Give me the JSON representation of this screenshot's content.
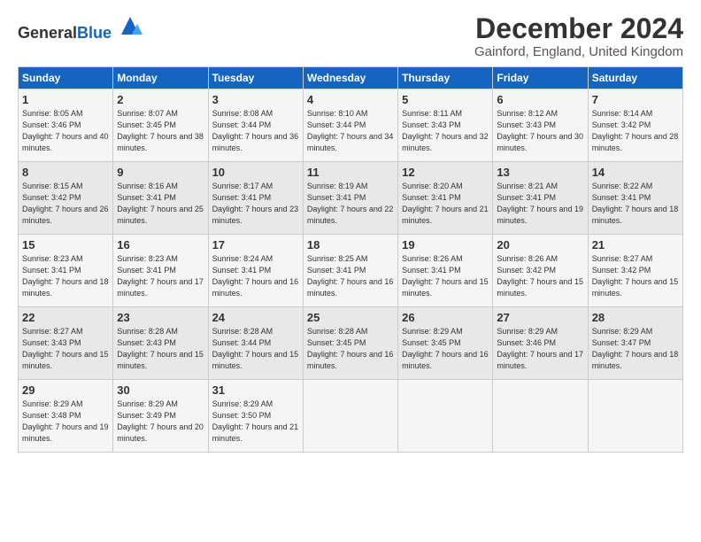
{
  "header": {
    "logo_general": "General",
    "logo_blue": "Blue",
    "month_title": "December 2024",
    "location": "Gainford, England, United Kingdom"
  },
  "days_of_week": [
    "Sunday",
    "Monday",
    "Tuesday",
    "Wednesday",
    "Thursday",
    "Friday",
    "Saturday"
  ],
  "weeks": [
    [
      {
        "day": "1",
        "sunrise": "Sunrise: 8:05 AM",
        "sunset": "Sunset: 3:46 PM",
        "daylight": "Daylight: 7 hours and 40 minutes."
      },
      {
        "day": "2",
        "sunrise": "Sunrise: 8:07 AM",
        "sunset": "Sunset: 3:45 PM",
        "daylight": "Daylight: 7 hours and 38 minutes."
      },
      {
        "day": "3",
        "sunrise": "Sunrise: 8:08 AM",
        "sunset": "Sunset: 3:44 PM",
        "daylight": "Daylight: 7 hours and 36 minutes."
      },
      {
        "day": "4",
        "sunrise": "Sunrise: 8:10 AM",
        "sunset": "Sunset: 3:44 PM",
        "daylight": "Daylight: 7 hours and 34 minutes."
      },
      {
        "day": "5",
        "sunrise": "Sunrise: 8:11 AM",
        "sunset": "Sunset: 3:43 PM",
        "daylight": "Daylight: 7 hours and 32 minutes."
      },
      {
        "day": "6",
        "sunrise": "Sunrise: 8:12 AM",
        "sunset": "Sunset: 3:43 PM",
        "daylight": "Daylight: 7 hours and 30 minutes."
      },
      {
        "day": "7",
        "sunrise": "Sunrise: 8:14 AM",
        "sunset": "Sunset: 3:42 PM",
        "daylight": "Daylight: 7 hours and 28 minutes."
      }
    ],
    [
      {
        "day": "8",
        "sunrise": "Sunrise: 8:15 AM",
        "sunset": "Sunset: 3:42 PM",
        "daylight": "Daylight: 7 hours and 26 minutes."
      },
      {
        "day": "9",
        "sunrise": "Sunrise: 8:16 AM",
        "sunset": "Sunset: 3:41 PM",
        "daylight": "Daylight: 7 hours and 25 minutes."
      },
      {
        "day": "10",
        "sunrise": "Sunrise: 8:17 AM",
        "sunset": "Sunset: 3:41 PM",
        "daylight": "Daylight: 7 hours and 23 minutes."
      },
      {
        "day": "11",
        "sunrise": "Sunrise: 8:19 AM",
        "sunset": "Sunset: 3:41 PM",
        "daylight": "Daylight: 7 hours and 22 minutes."
      },
      {
        "day": "12",
        "sunrise": "Sunrise: 8:20 AM",
        "sunset": "Sunset: 3:41 PM",
        "daylight": "Daylight: 7 hours and 21 minutes."
      },
      {
        "day": "13",
        "sunrise": "Sunrise: 8:21 AM",
        "sunset": "Sunset: 3:41 PM",
        "daylight": "Daylight: 7 hours and 19 minutes."
      },
      {
        "day": "14",
        "sunrise": "Sunrise: 8:22 AM",
        "sunset": "Sunset: 3:41 PM",
        "daylight": "Daylight: 7 hours and 18 minutes."
      }
    ],
    [
      {
        "day": "15",
        "sunrise": "Sunrise: 8:23 AM",
        "sunset": "Sunset: 3:41 PM",
        "daylight": "Daylight: 7 hours and 18 minutes."
      },
      {
        "day": "16",
        "sunrise": "Sunrise: 8:23 AM",
        "sunset": "Sunset: 3:41 PM",
        "daylight": "Daylight: 7 hours and 17 minutes."
      },
      {
        "day": "17",
        "sunrise": "Sunrise: 8:24 AM",
        "sunset": "Sunset: 3:41 PM",
        "daylight": "Daylight: 7 hours and 16 minutes."
      },
      {
        "day": "18",
        "sunrise": "Sunrise: 8:25 AM",
        "sunset": "Sunset: 3:41 PM",
        "daylight": "Daylight: 7 hours and 16 minutes."
      },
      {
        "day": "19",
        "sunrise": "Sunrise: 8:26 AM",
        "sunset": "Sunset: 3:41 PM",
        "daylight": "Daylight: 7 hours and 15 minutes."
      },
      {
        "day": "20",
        "sunrise": "Sunrise: 8:26 AM",
        "sunset": "Sunset: 3:42 PM",
        "daylight": "Daylight: 7 hours and 15 minutes."
      },
      {
        "day": "21",
        "sunrise": "Sunrise: 8:27 AM",
        "sunset": "Sunset: 3:42 PM",
        "daylight": "Daylight: 7 hours and 15 minutes."
      }
    ],
    [
      {
        "day": "22",
        "sunrise": "Sunrise: 8:27 AM",
        "sunset": "Sunset: 3:43 PM",
        "daylight": "Daylight: 7 hours and 15 minutes."
      },
      {
        "day": "23",
        "sunrise": "Sunrise: 8:28 AM",
        "sunset": "Sunset: 3:43 PM",
        "daylight": "Daylight: 7 hours and 15 minutes."
      },
      {
        "day": "24",
        "sunrise": "Sunrise: 8:28 AM",
        "sunset": "Sunset: 3:44 PM",
        "daylight": "Daylight: 7 hours and 15 minutes."
      },
      {
        "day": "25",
        "sunrise": "Sunrise: 8:28 AM",
        "sunset": "Sunset: 3:45 PM",
        "daylight": "Daylight: 7 hours and 16 minutes."
      },
      {
        "day": "26",
        "sunrise": "Sunrise: 8:29 AM",
        "sunset": "Sunset: 3:45 PM",
        "daylight": "Daylight: 7 hours and 16 minutes."
      },
      {
        "day": "27",
        "sunrise": "Sunrise: 8:29 AM",
        "sunset": "Sunset: 3:46 PM",
        "daylight": "Daylight: 7 hours and 17 minutes."
      },
      {
        "day": "28",
        "sunrise": "Sunrise: 8:29 AM",
        "sunset": "Sunset: 3:47 PM",
        "daylight": "Daylight: 7 hours and 18 minutes."
      }
    ],
    [
      {
        "day": "29",
        "sunrise": "Sunrise: 8:29 AM",
        "sunset": "Sunset: 3:48 PM",
        "daylight": "Daylight: 7 hours and 19 minutes."
      },
      {
        "day": "30",
        "sunrise": "Sunrise: 8:29 AM",
        "sunset": "Sunset: 3:49 PM",
        "daylight": "Daylight: 7 hours and 20 minutes."
      },
      {
        "day": "31",
        "sunrise": "Sunrise: 8:29 AM",
        "sunset": "Sunset: 3:50 PM",
        "daylight": "Daylight: 7 hours and 21 minutes."
      },
      null,
      null,
      null,
      null
    ]
  ]
}
